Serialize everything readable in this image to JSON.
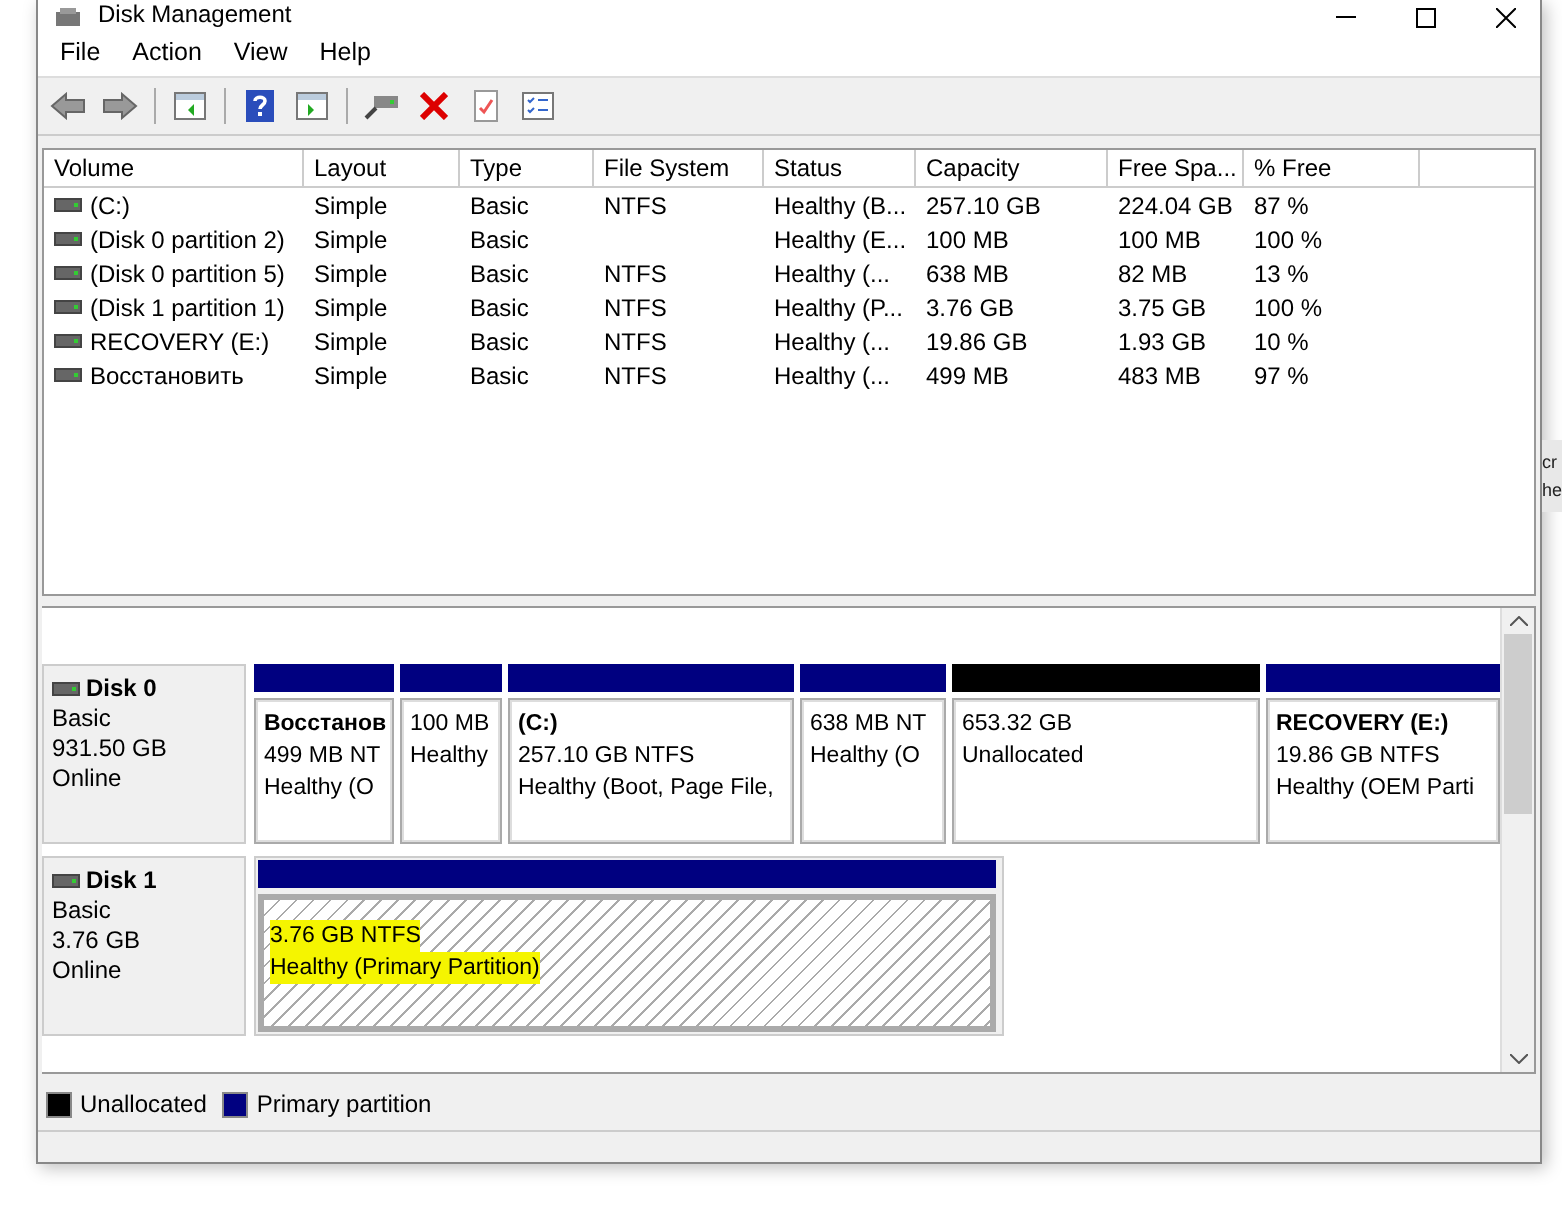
{
  "window": {
    "title": "Disk Management"
  },
  "menu": [
    "File",
    "Action",
    "View",
    "Help"
  ],
  "volumes": {
    "columns": [
      "Volume",
      "Layout",
      "Type",
      "File System",
      "Status",
      "Capacity",
      "Free Spa...",
      "% Free"
    ],
    "rows": [
      {
        "cells": [
          "(C:)",
          "Simple",
          "Basic",
          "NTFS",
          "Healthy (B...",
          "257.10 GB",
          "224.04 GB",
          "87 %"
        ]
      },
      {
        "cells": [
          "(Disk 0 partition 2)",
          "Simple",
          "Basic",
          "",
          "Healthy (E...",
          "100 MB",
          "100 MB",
          "100 %"
        ]
      },
      {
        "cells": [
          "(Disk 0 partition 5)",
          "Simple",
          "Basic",
          "NTFS",
          "Healthy (...",
          "638 MB",
          "82 MB",
          "13 %"
        ]
      },
      {
        "cells": [
          "(Disk 1 partition 1)",
          "Simple",
          "Basic",
          "NTFS",
          "Healthy (P...",
          "3.76 GB",
          "3.75 GB",
          "100 %"
        ]
      },
      {
        "cells": [
          "RECOVERY (E:)",
          "Simple",
          "Basic",
          "NTFS",
          "Healthy (...",
          "19.86 GB",
          "1.93 GB",
          "10 %"
        ]
      },
      {
        "cells": [
          "Восстановить",
          "Simple",
          "Basic",
          "NTFS",
          "Healthy (...",
          "499 MB",
          "483 MB",
          "97 %"
        ]
      }
    ]
  },
  "disks": [
    {
      "name": "Disk 0",
      "type": "Basic",
      "size": "931.50 GB",
      "status": "Online",
      "partitions": [
        {
          "kind": "primary",
          "selected": false,
          "highlighted": false,
          "label": "Восстанов",
          "size": "499 MB NT",
          "status": "Healthy (O"
        },
        {
          "kind": "primary",
          "selected": false,
          "highlighted": false,
          "size": "100 MB",
          "status": "Healthy"
        },
        {
          "kind": "primary",
          "selected": false,
          "highlighted": false,
          "label": "(C:)",
          "size": "257.10 GB NTFS",
          "status": "Healthy (Boot, Page File,"
        },
        {
          "kind": "primary",
          "selected": false,
          "highlighted": false,
          "size": "638 MB NT",
          "status": "Healthy (O"
        },
        {
          "kind": "unallocated",
          "selected": false,
          "highlighted": false,
          "size": "653.32 GB",
          "status": "Unallocated"
        },
        {
          "kind": "primary",
          "selected": false,
          "highlighted": false,
          "label": "RECOVERY  (E:)",
          "size": "19.86 GB NTFS",
          "status": "Healthy (OEM Parti"
        }
      ]
    },
    {
      "name": "Disk 1",
      "type": "Basic",
      "size": "3.76 GB",
      "status": "Online",
      "partitions": [
        {
          "kind": "primary",
          "selected": true,
          "highlighted": true,
          "size": "3.76 GB NTFS",
          "status": "Healthy (Primary Partition)"
        }
      ]
    }
  ],
  "legend": [
    {
      "label": "Unallocated",
      "color": "#000000"
    },
    {
      "label": "Primary partition",
      "color": "#000080"
    }
  ],
  "background_window": {
    "lines": [
      "cr",
      "he"
    ]
  }
}
